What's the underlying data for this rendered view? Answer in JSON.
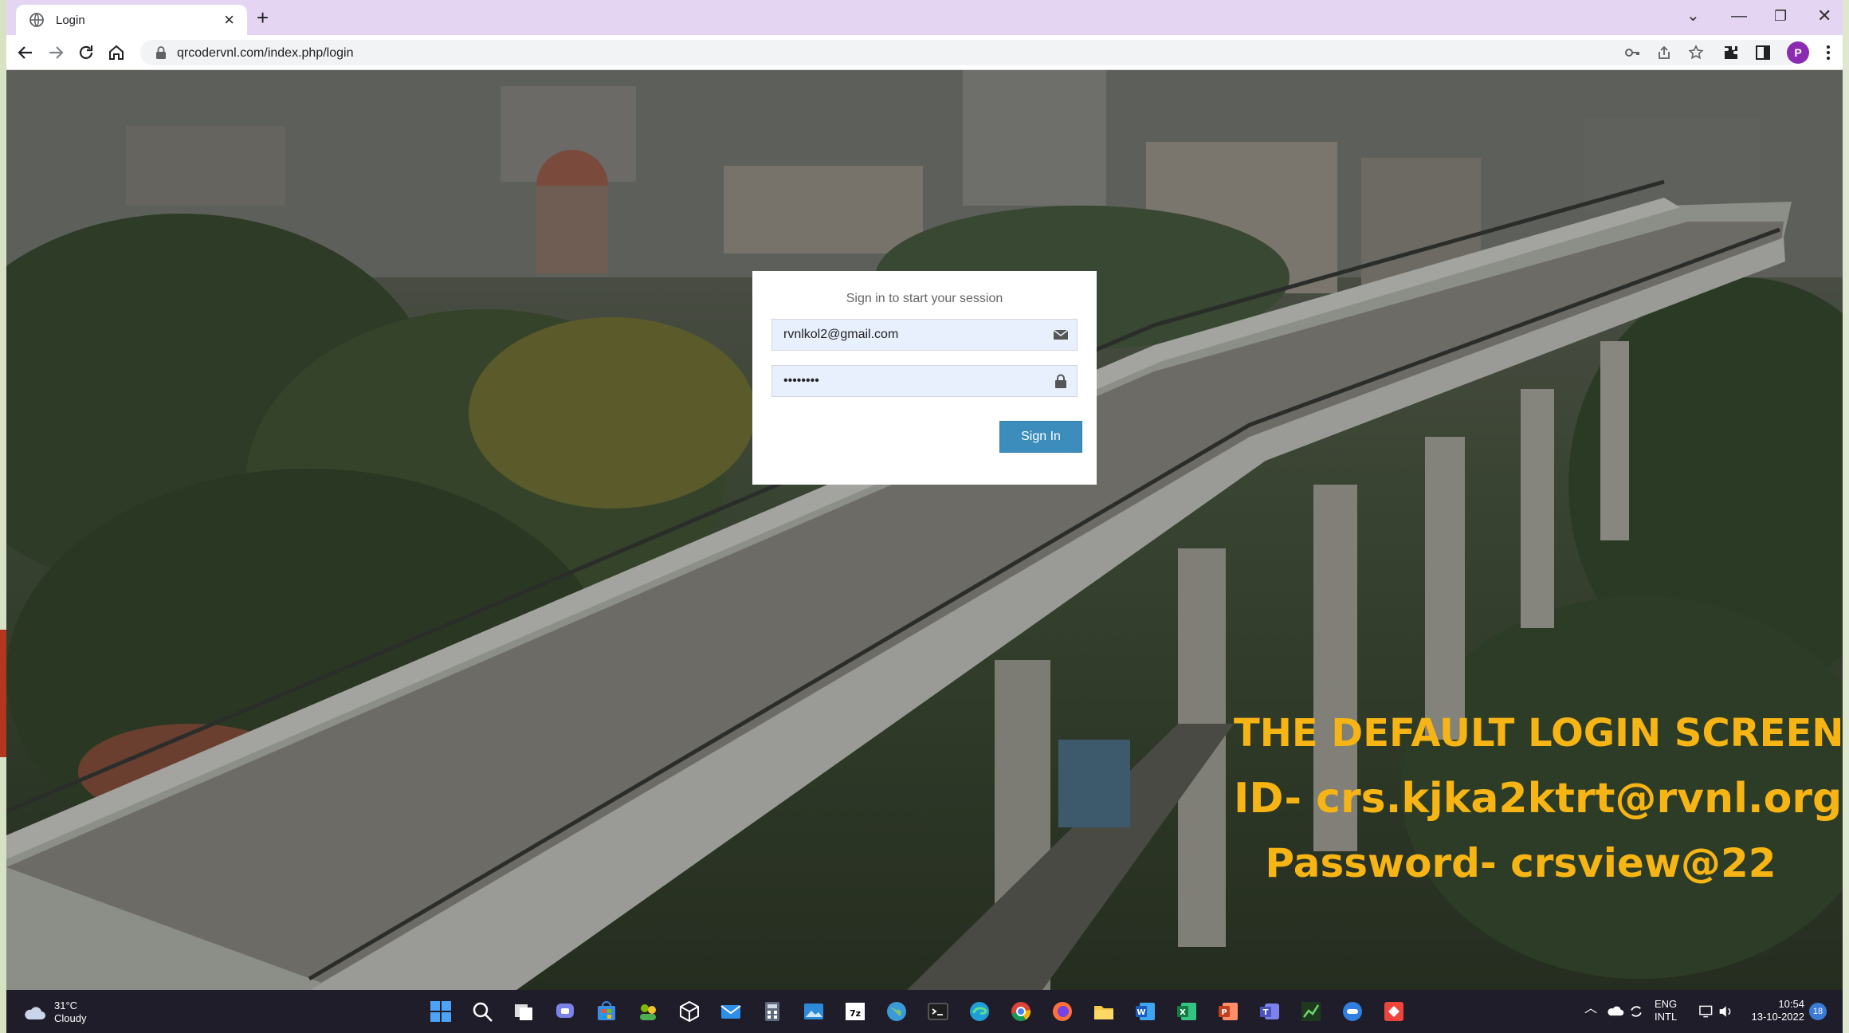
{
  "browser": {
    "tab_title": "Login",
    "url": "qrcodervnl.com/index.php/login",
    "profile_initial": "P"
  },
  "login": {
    "message": "Sign in to start your session",
    "email_value": "rvnlkol2@gmail.com",
    "password_value": "••••••••",
    "signin_label": "Sign In"
  },
  "caption": {
    "line1": "THE DEFAULT LOGIN SCREEN",
    "line2": "ID- crs.kjka2ktrt@rvnl.org",
    "line3": "Password- crsview@22"
  },
  "taskbar": {
    "temperature": "31°C",
    "condition": "Cloudy",
    "lang_top": "ENG",
    "lang_bottom": "INTL",
    "time": "10:54",
    "date": "13-10-2022",
    "notifications": "18"
  },
  "colors": {
    "tabstrip": "#e4d6f3",
    "signin_button": "#3c8dbc",
    "caption_text": "#f7b515",
    "taskbar": "#201d2b"
  }
}
